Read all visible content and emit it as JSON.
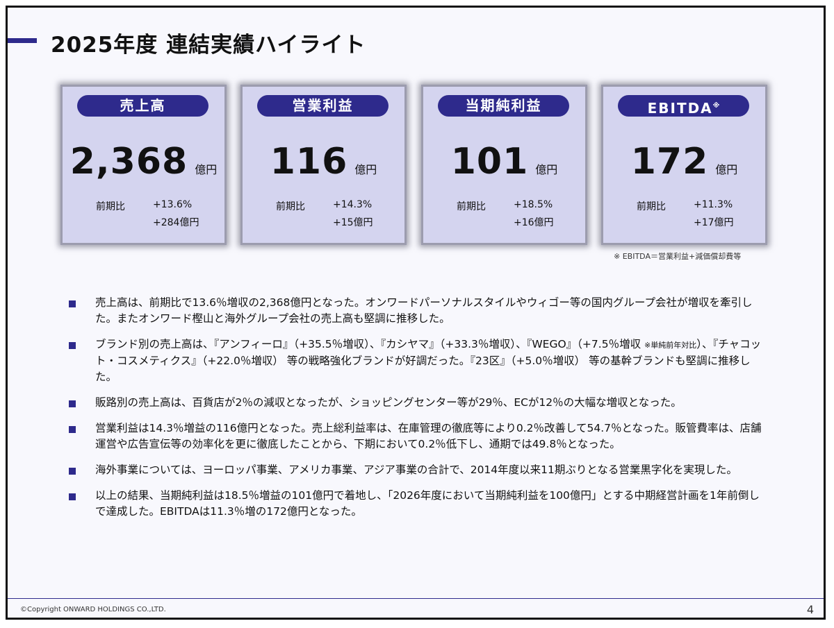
{
  "header": {
    "title": "2025年度 連結実績ハイライト"
  },
  "colors": {
    "accent": "#2e2a8c",
    "card_bg": "#d4d4ef",
    "slide_bg": "#f8f8fd"
  },
  "cards": [
    {
      "label": "売上高",
      "value": "2,368",
      "unit": "億円",
      "compare_label": "前期比",
      "change_pct": "+13.6%",
      "change_abs": "+284億円"
    },
    {
      "label": "営業利益",
      "value": "116",
      "unit": "億円",
      "compare_label": "前期比",
      "change_pct": "+14.3%",
      "change_abs": "+15億円"
    },
    {
      "label": "当期純利益",
      "value": "101",
      "unit": "億円",
      "compare_label": "前期比",
      "change_pct": "+18.5%",
      "change_abs": "+16億円"
    },
    {
      "label": "EBITDA",
      "label_mark": "※",
      "value": "172",
      "unit": "億円",
      "compare_label": "前期比",
      "change_pct": "+11.3%",
      "change_abs": "+17億円"
    }
  ],
  "footnote": "※ EBITDA＝営業利益+減価償却費等",
  "bullets": [
    {
      "text": "売上高は、前期比で13.6％増収の2,368億円となった。オンワードパーソナルスタイルやウィゴー等の国内グループ会社が増収を牽引した。またオンワード樫山と海外グループ会社の売上高も堅調に推移した。"
    },
    {
      "text": "ブランド別の売上高は、『アンフィーロ』（+35.5％増収）、『カシヤマ』（+33.3％増収）、『WEGO』（+7.5％増収 ",
      "note": "※単純前年対比",
      "text_after": "）、『チャコット・コスメティクス』（+22.0％増収） 等の戦略強化ブランドが好調だった。『23区』（+5.0％増収） 等の基幹ブランドも堅調に推移した。"
    },
    {
      "text": "販路別の売上高は、百貨店が2％の減収となったが、ショッピングセンター等が29％、ECが12％の大幅な増収となった。"
    },
    {
      "text": "営業利益は14.3％増益の116億円となった。売上総利益率は、在庫管理の徹底等により0.2％改善して54.7％となった。販管費率は、店舗運営や広告宣伝等の効率化を更に徹底したことから、下期において0.2％低下し、通期では49.8％となった。"
    },
    {
      "text": "海外事業については、ヨーロッパ事業、アメリカ事業、アジア事業の合計で、2014年度以来11期ぶりとなる営業黒字化を実現した。"
    },
    {
      "text": "以上の結果、当期純利益は18.5％増益の101億円で着地し、「2026年度において当期純利益を100億円」とする中期経営計画を1年前倒しで達成した。EBITDAは11.3％増の172億円となった。"
    }
  ],
  "footer": {
    "copyright": "©Copyright ONWARD HOLDINGS CO.,LTD.",
    "page": "4"
  }
}
